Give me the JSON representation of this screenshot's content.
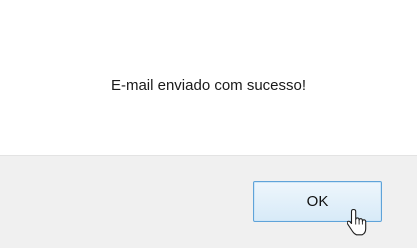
{
  "dialog": {
    "message": "E-mail enviado com sucesso!",
    "ok_label": "OK"
  },
  "cursor": {
    "icon": "hand-pointer-icon"
  }
}
